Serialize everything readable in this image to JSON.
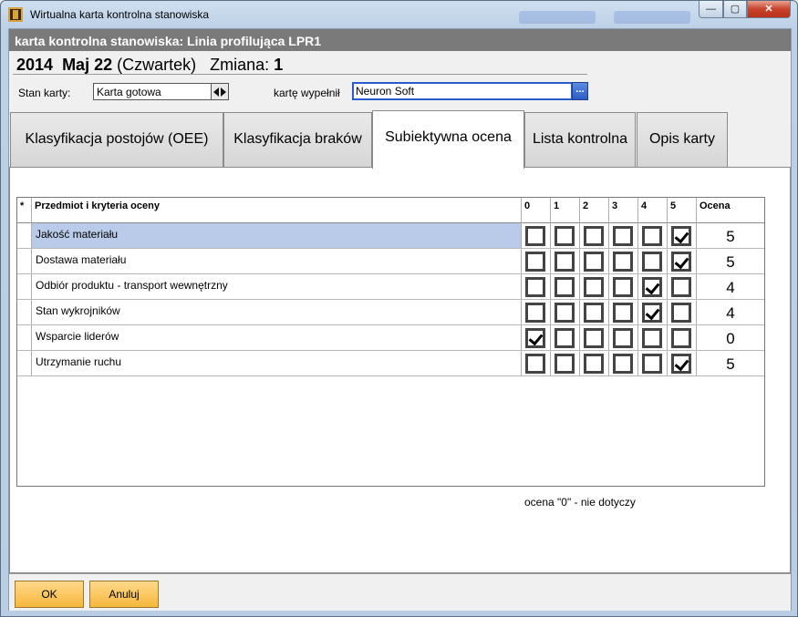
{
  "window": {
    "title": "Wirtualna karta kontrolna stanowiska",
    "controls": {
      "minimize": "—",
      "maximize": "▢",
      "close": "✕"
    }
  },
  "header": {
    "title": "karta kontrolna stanowiska: Linia profilująca LPR1"
  },
  "dateline": {
    "year": "2014",
    "month_day": "Maj 22",
    "weekday": "(Czwartek)",
    "shift_label": "Zmiana:",
    "shift_value": "1"
  },
  "form": {
    "status_label": "Stan karty:",
    "status_value": "Karta gotowa",
    "filled_label": "kartę wypełnił",
    "filled_value": "Neuron  Soft",
    "browse_label": "..."
  },
  "tabs": [
    {
      "label": "Klasyfikacja postojów (OEE)"
    },
    {
      "label": "Klasyfikacja braków"
    },
    {
      "label": "Subiektywna ocena"
    },
    {
      "label": "Lista kontrolna"
    },
    {
      "label": "Opis karty"
    }
  ],
  "active_tab": 2,
  "grid": {
    "columns": {
      "star": "*",
      "subject": "Przedmiot i kryteria oceny",
      "levels": [
        "0",
        "1",
        "2",
        "3",
        "4",
        "5"
      ],
      "score": "Ocena"
    },
    "rows": [
      {
        "name": "Jakość materiału",
        "checked": 5,
        "score": "5",
        "selected": true
      },
      {
        "name": "Dostawa materiału",
        "checked": 5,
        "score": "5"
      },
      {
        "name": "Odbiór produktu - transport wewnętrzny",
        "checked": 4,
        "score": "4"
      },
      {
        "name": "Stan wykrojników",
        "checked": 4,
        "score": "4"
      },
      {
        "name": "Wsparcie liderów",
        "checked": 0,
        "score": "0"
      },
      {
        "name": "Utrzymanie ruchu",
        "checked": 5,
        "score": "5"
      }
    ]
  },
  "note": "ocena \"0\" - nie dotyczy",
  "buttons": {
    "ok": "OK",
    "cancel": "Anuluj"
  }
}
